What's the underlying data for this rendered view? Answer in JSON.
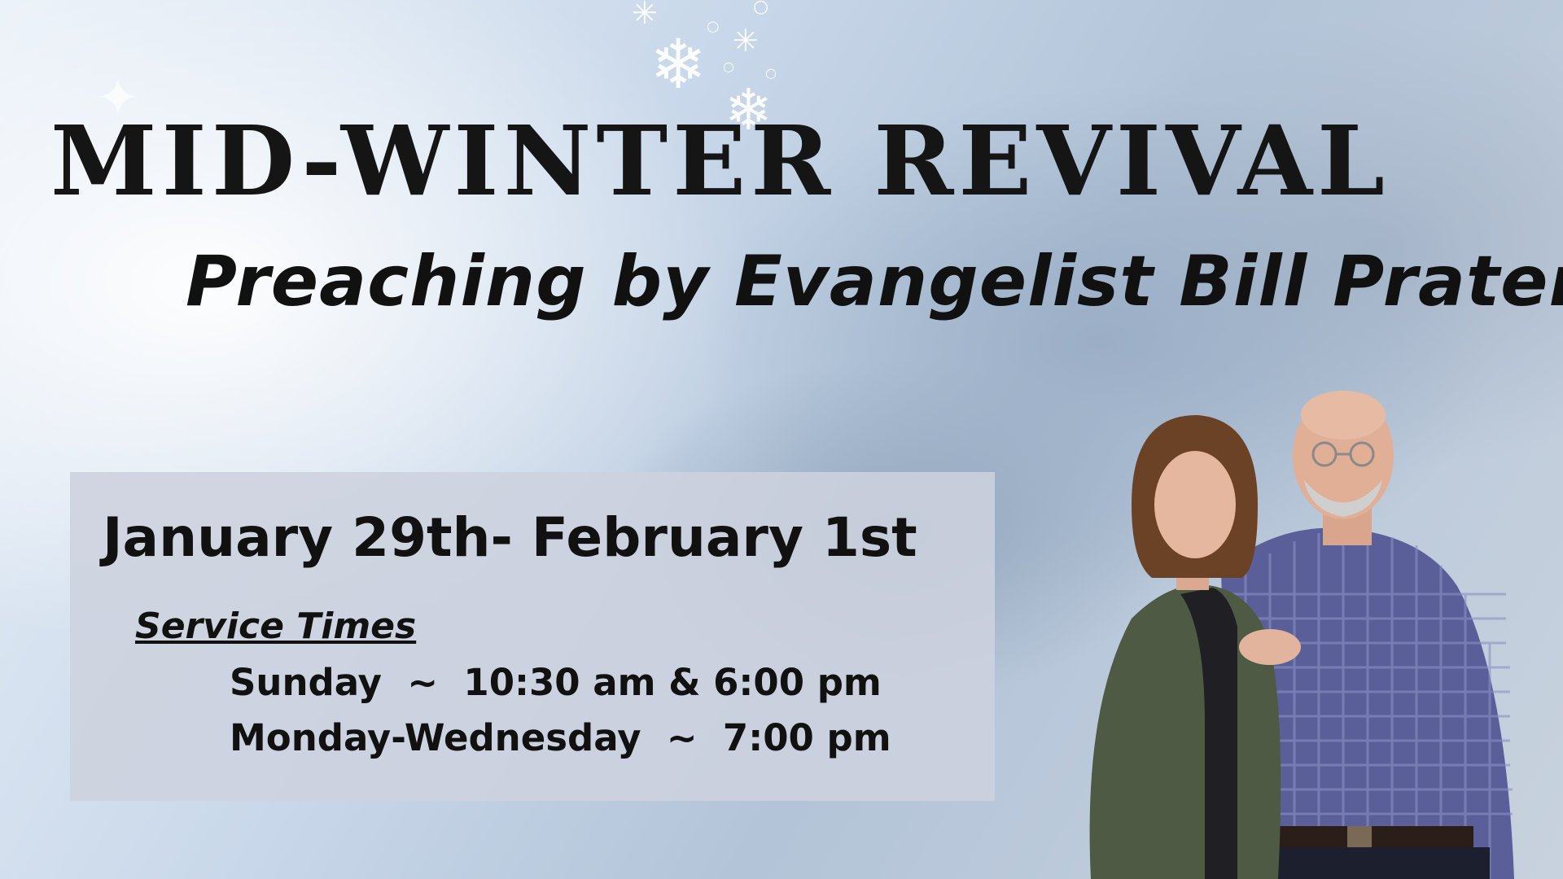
{
  "title": "MID-WINTER REVIVAL",
  "subtitle": "Preaching by Evangelist Bill Prater",
  "dates": "January 29th- February 1st",
  "service": {
    "label": "Service Times",
    "lines": [
      "Sunday  ~  10:30 am & 6:00 pm",
      "Monday-Wednesday  ~  7:00 pm"
    ]
  },
  "icons": [
    "snowflake-icon",
    "sparkle-icon"
  ],
  "colors": {
    "text": "#111111",
    "box": "#cdd2de",
    "shirt": "#5a5f9a",
    "jacket": "#4e5a44"
  }
}
